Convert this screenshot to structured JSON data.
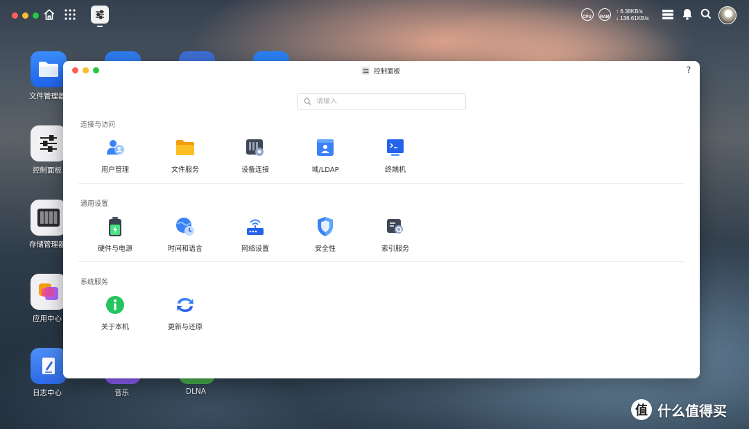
{
  "topbar": {
    "gauges": {
      "cpu": "CPU",
      "ram": "RAM"
    },
    "net": {
      "up": "↑ 6.38KB/s",
      "down": "↓ 136.61KB/s"
    }
  },
  "desktop": {
    "icons": [
      {
        "label": "文件管理器"
      },
      {
        "label": "控制面板"
      },
      {
        "label": "存储管理器"
      },
      {
        "label": "应用中心"
      },
      {
        "label": "日志中心"
      },
      {
        "label": "音乐"
      },
      {
        "label": "DLNA"
      }
    ]
  },
  "window": {
    "title": "控制面板",
    "help": "?",
    "search": {
      "placeholder": "请输入",
      "value": ""
    },
    "sections": [
      {
        "title": "连接与访问",
        "items": [
          {
            "label": "用户管理",
            "icon": "users-icon"
          },
          {
            "label": "文件服务",
            "icon": "folder-icon"
          },
          {
            "label": "设备连接",
            "icon": "device-icon"
          },
          {
            "label": "域/LDAP",
            "icon": "ldap-icon"
          },
          {
            "label": "终端机",
            "icon": "terminal-icon"
          }
        ]
      },
      {
        "title": "通用设置",
        "items": [
          {
            "label": "硬件与电源",
            "icon": "battery-icon"
          },
          {
            "label": "时间和语言",
            "icon": "globe-clock-icon"
          },
          {
            "label": "网络设置",
            "icon": "router-icon"
          },
          {
            "label": "安全性",
            "icon": "shield-icon"
          },
          {
            "label": "索引服务",
            "icon": "index-search-icon"
          }
        ]
      },
      {
        "title": "系统服务",
        "items": [
          {
            "label": "关于本机",
            "icon": "info-icon"
          },
          {
            "label": "更新与还原",
            "icon": "sync-icon"
          }
        ]
      }
    ]
  },
  "watermark": {
    "badge": "值",
    "text": "什么值得买"
  },
  "colors": {
    "accent": "#3b82f6",
    "window_bg": "#ffffff",
    "text": "#333333"
  }
}
